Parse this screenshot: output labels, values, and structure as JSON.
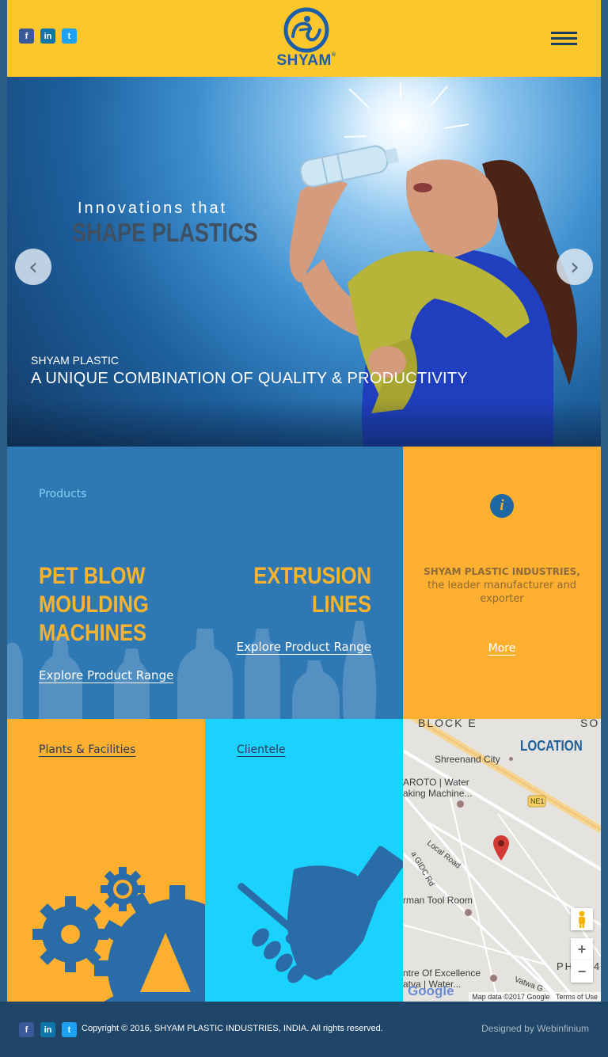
{
  "header": {
    "social": {
      "facebook": "f",
      "linkedin": "in",
      "twitter": "t"
    },
    "logo_text": "SHYAM",
    "logo_reg": "®"
  },
  "hero": {
    "tagline_line1": "Innovations that",
    "tagline_line2": "SHAPE PLASTICS",
    "caption_small": "SHYAM PLASTIC",
    "caption_large": "A UNIQUE COMBINATION OF QUALITY & PRODUCTIVITY",
    "prev_icon": "‹",
    "next_icon": "›"
  },
  "products": {
    "label": "Products",
    "item1": {
      "title_l1": "PET BLOW",
      "title_l2": "MOULDING",
      "title_l3": "MACHINES",
      "link": "Explore Product Range"
    },
    "item2": {
      "title_l1": "EXTRUSION",
      "title_l2": "LINES",
      "link": "Explore Product Range"
    }
  },
  "info": {
    "icon": "i",
    "company": "SHYAM PLASTIC INDUSTRIES,",
    "description": "the leader manufacturer and exporter",
    "more": "More"
  },
  "tiles": {
    "plants": "Plants & Facilities",
    "clientele": "Clientele"
  },
  "map": {
    "title": "LOCATION",
    "labels": {
      "block_e": "BLOCK E",
      "so": "SO",
      "shreenand": "Shreenand City",
      "aroto_1": "AROTO | Water",
      "aroto_2": "aking Machine...",
      "ne1": "NE1",
      "local_road": "Local Road",
      "gidc": "a GIDC Rd",
      "rman": "rman Tool Room",
      "pha": "PHA",
      "pha_num": "4",
      "centre_1": "ntre Of Excellence",
      "centre_2": "atva | Water...",
      "vatwa": "Vatwa G"
    },
    "zoom_in": "+",
    "zoom_out": "−",
    "google": "Google",
    "map_data": "Map data ©2017 Google",
    "terms": "Terms of Use"
  },
  "footer": {
    "social": {
      "facebook": "f",
      "linkedin": "in",
      "twitter": "t"
    },
    "copyright": "Copyright © 2016, SHYAM PLASTIC INDUSTRIES, INDIA. All rights reserved.",
    "designed_by": "Designed by Webinfinium"
  },
  "colors": {
    "header_bg": "#fdc72b",
    "products_bg": "#2e78b4",
    "orange": "#fdb030",
    "cyan": "#1ad2fc",
    "footer_bg": "#1f4568",
    "brand_blue": "#1c5ea8"
  }
}
